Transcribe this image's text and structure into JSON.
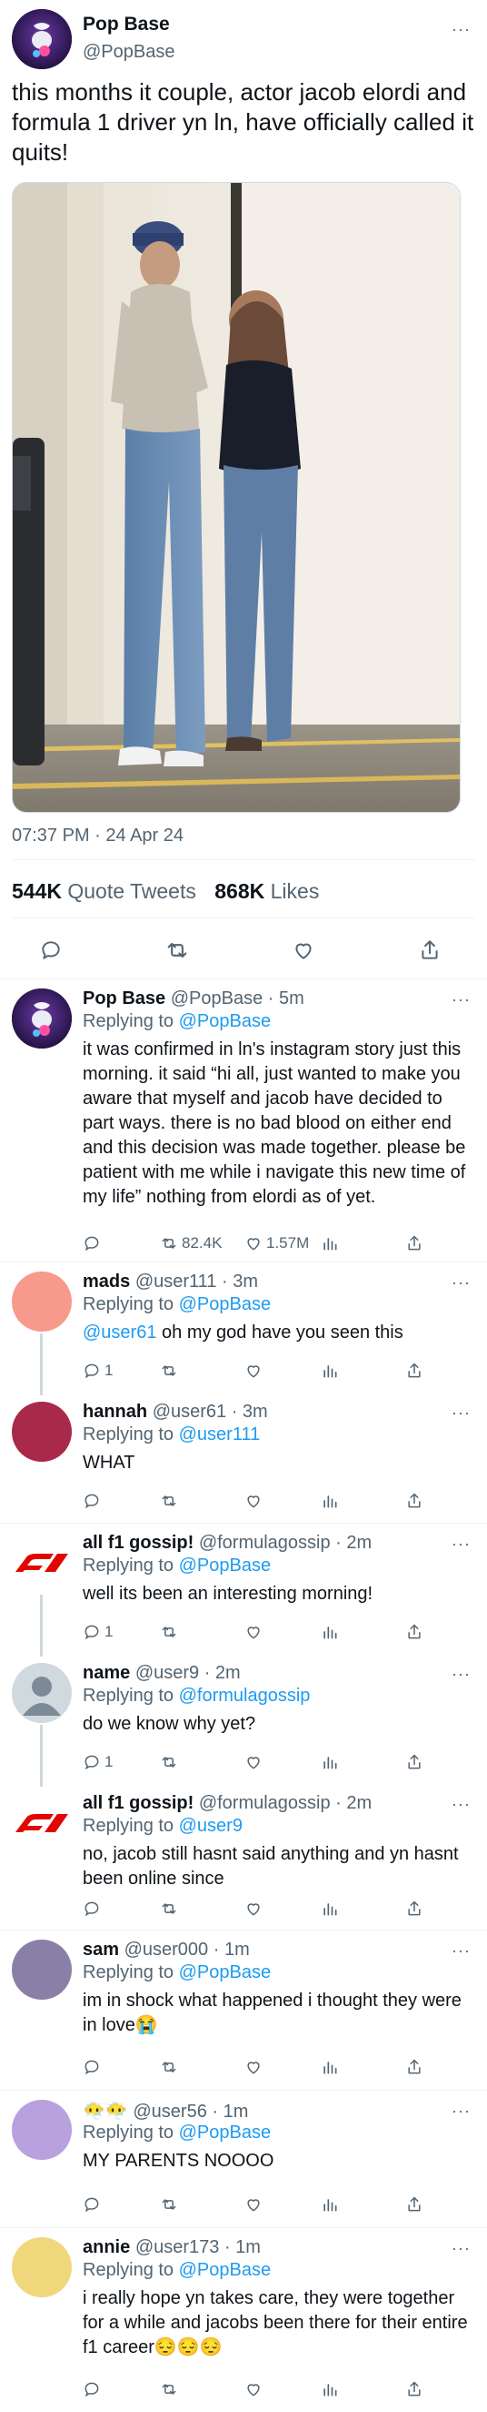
{
  "main_tweet": {
    "author_name": "Pop Base",
    "author_handle": "@PopBase",
    "text": "this months it couple, actor jacob elordi and formula 1 driver yn ln, have officially called it quits!",
    "timestamp": "07:37 PM · 24 Apr 24",
    "quote_tweets_count": "544K",
    "quote_tweets_label": "Quote Tweets",
    "likes_count": "868K",
    "likes_label": "Likes",
    "more_label": "···"
  },
  "replies": [
    {
      "name": "Pop Base",
      "handle_time": "@PopBase · 5m",
      "replying_label": "Replying to",
      "replying_to": "@PopBase",
      "text": "it was confirmed in ln's instagram story just this morning. it said “hi all, just wanted to make you aware that myself and jacob have decided to part ways. there is no bad blood on either end and this decision was made together. please be patient with me while i navigate this new time of my life” nothing from elordi as of yet.",
      "retweets": "82.4K",
      "likes": "1.57M",
      "avatar": "popbase-logo"
    },
    {
      "name": "mads",
      "handle_time": "@user111 · 3m",
      "replying_label": "Replying to",
      "replying_to": "@PopBase",
      "mention": "@user61",
      "text": " oh my god have you seen this",
      "replies": "1",
      "avatar_color": "#f79a8c"
    },
    {
      "name": "hannah",
      "handle_time": "@user61 · 3m",
      "replying_label": "Replying to",
      "replying_to": "@user111",
      "text": "WHAT",
      "avatar_color": "#a8294a"
    },
    {
      "name": "all f1 gossip!",
      "handle_time": "@formulagossip · 2m",
      "replying_label": "Replying to",
      "replying_to": "@PopBase",
      "text": "well its been an interesting morning!",
      "replies": "1",
      "avatar": "f1-logo"
    },
    {
      "name": "name",
      "handle_time": "@user9 · 2m",
      "replying_label": "Replying to",
      "replying_to": "@formulagossip",
      "text": "do we know why yet?",
      "replies": "1",
      "avatar": "default-person"
    },
    {
      "name": "all f1 gossip!",
      "handle_time": "@formulagossip · 2m",
      "replying_label": "Replying to",
      "replying_to": "@user9",
      "text": "no, jacob still hasnt said anything and yn hasnt been online since",
      "avatar": "f1-logo"
    },
    {
      "name": "sam",
      "handle_time": "@user000 · 1m",
      "replying_label": "Replying to",
      "replying_to": "@PopBase",
      "text": "im in shock what happened i thought they were in love😭",
      "avatar_color": "#8a7fa6"
    },
    {
      "name": "😶‍🌫️😶‍🌫️",
      "handle_time": "@user56 · 1m",
      "replying_label": "Replying to",
      "replying_to": "@PopBase",
      "text": "MY PARENTS NOOOO",
      "avatar_color": "#b9a0de"
    },
    {
      "name": "annie",
      "handle_time": "@user173 · 1m",
      "replying_label": "Replying to",
      "replying_to": "@PopBase",
      "text": "i really hope yn takes care, they were together for a while and jacobs been there for their entire f1 career😔😔😔",
      "avatar_color": "#f1d77c"
    }
  ],
  "icons": {
    "reply": "reply-icon",
    "retweet": "retweet-icon",
    "like": "heart-icon",
    "analytics": "analytics-icon",
    "share": "share-icon",
    "more": "more-icon"
  },
  "colors": {
    "accent": "#1d9bf0",
    "muted": "#536471",
    "f1_red": "#e10600"
  }
}
